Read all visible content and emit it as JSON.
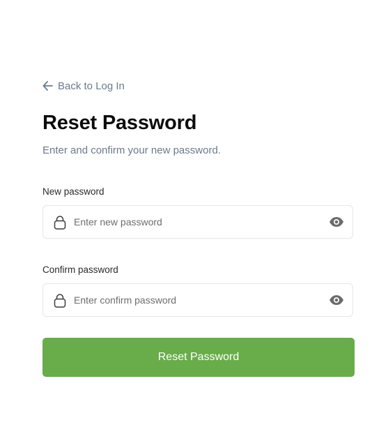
{
  "back_link": {
    "label": "Back to Log In",
    "icon": "arrow-left-icon"
  },
  "title": "Reset Password",
  "subtitle": "Enter and confirm your new password.",
  "fields": [
    {
      "label": "New password",
      "placeholder": "Enter new password",
      "value": "",
      "icon": "lock-icon",
      "toggle_icon": "eye-icon"
    },
    {
      "label": "Confirm password",
      "placeholder": "Enter confirm password",
      "value": "",
      "icon": "lock-icon",
      "toggle_icon": "eye-icon"
    }
  ],
  "submit_label": "Reset Password",
  "colors": {
    "accent": "#69ac4a",
    "muted_text": "#6b7a8c",
    "input_border": "#e3e6ea"
  }
}
